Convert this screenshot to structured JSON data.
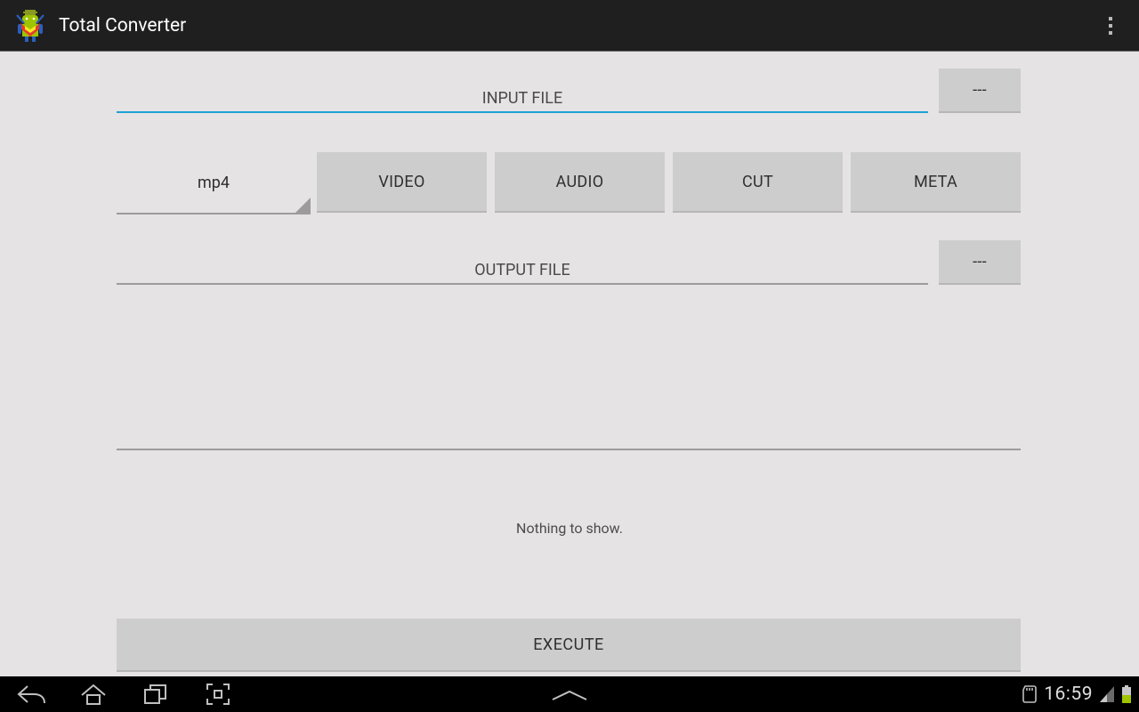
{
  "header": {
    "title": "Total Converter"
  },
  "input": {
    "label": "INPUT FILE",
    "browse": "---"
  },
  "format": {
    "selected": "mp4"
  },
  "tabs": {
    "video": "VIDEO",
    "audio": "AUDIO",
    "cut": "CUT",
    "meta": "META"
  },
  "output": {
    "label": "OUTPUT FILE",
    "browse": "---"
  },
  "status": {
    "text": "Nothing to show."
  },
  "execute": {
    "label": "EXECUTE"
  },
  "system": {
    "clock": "16:59"
  }
}
